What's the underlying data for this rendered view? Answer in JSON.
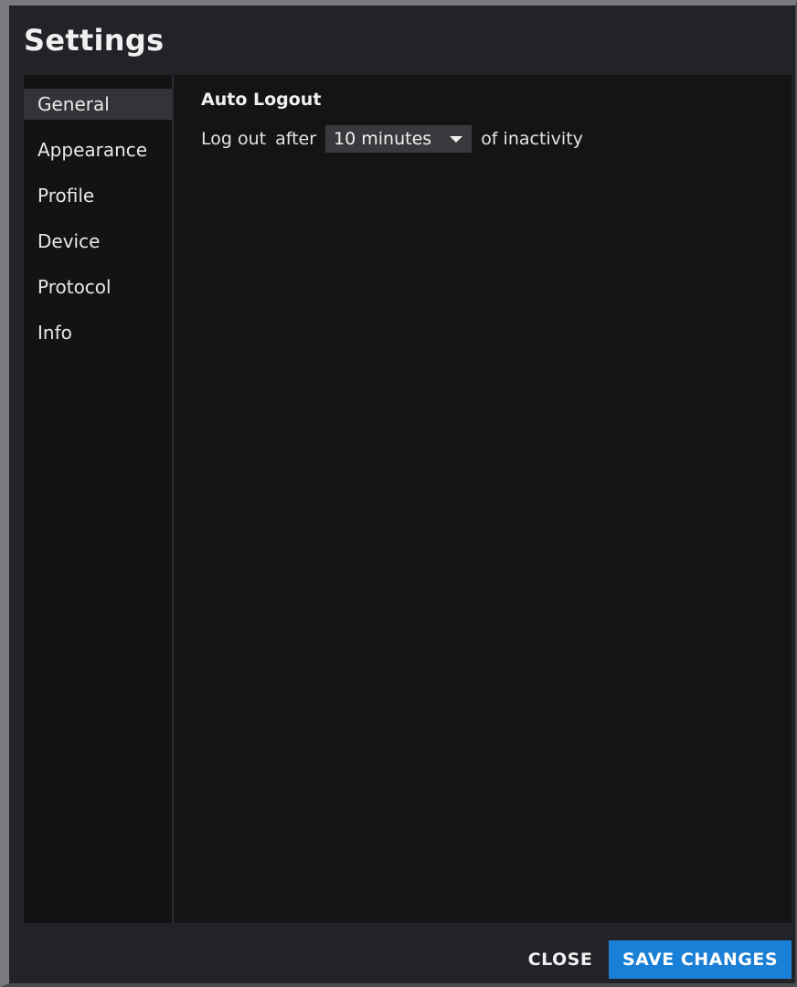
{
  "window": {
    "title": "Settings"
  },
  "sidebar": {
    "items": [
      {
        "label": "General",
        "active": true
      },
      {
        "label": "Appearance",
        "active": false
      },
      {
        "label": "Profile",
        "active": false
      },
      {
        "label": "Device",
        "active": false
      },
      {
        "label": "Protocol",
        "active": false
      },
      {
        "label": "Info",
        "active": false
      }
    ]
  },
  "general": {
    "heading": "Auto Logout",
    "prefix_1": "Log out",
    "prefix_2": "after",
    "select_value": "10 minutes",
    "suffix": "of inactivity",
    "select_icon": "caret-down-icon"
  },
  "footer": {
    "close_label": "CLOSE",
    "save_label": "SAVE CHANGES"
  },
  "colors": {
    "window_bg": "#222328",
    "panel_bg": "#141415",
    "active_item_bg": "#333437",
    "accent": "#1a7fd6"
  }
}
